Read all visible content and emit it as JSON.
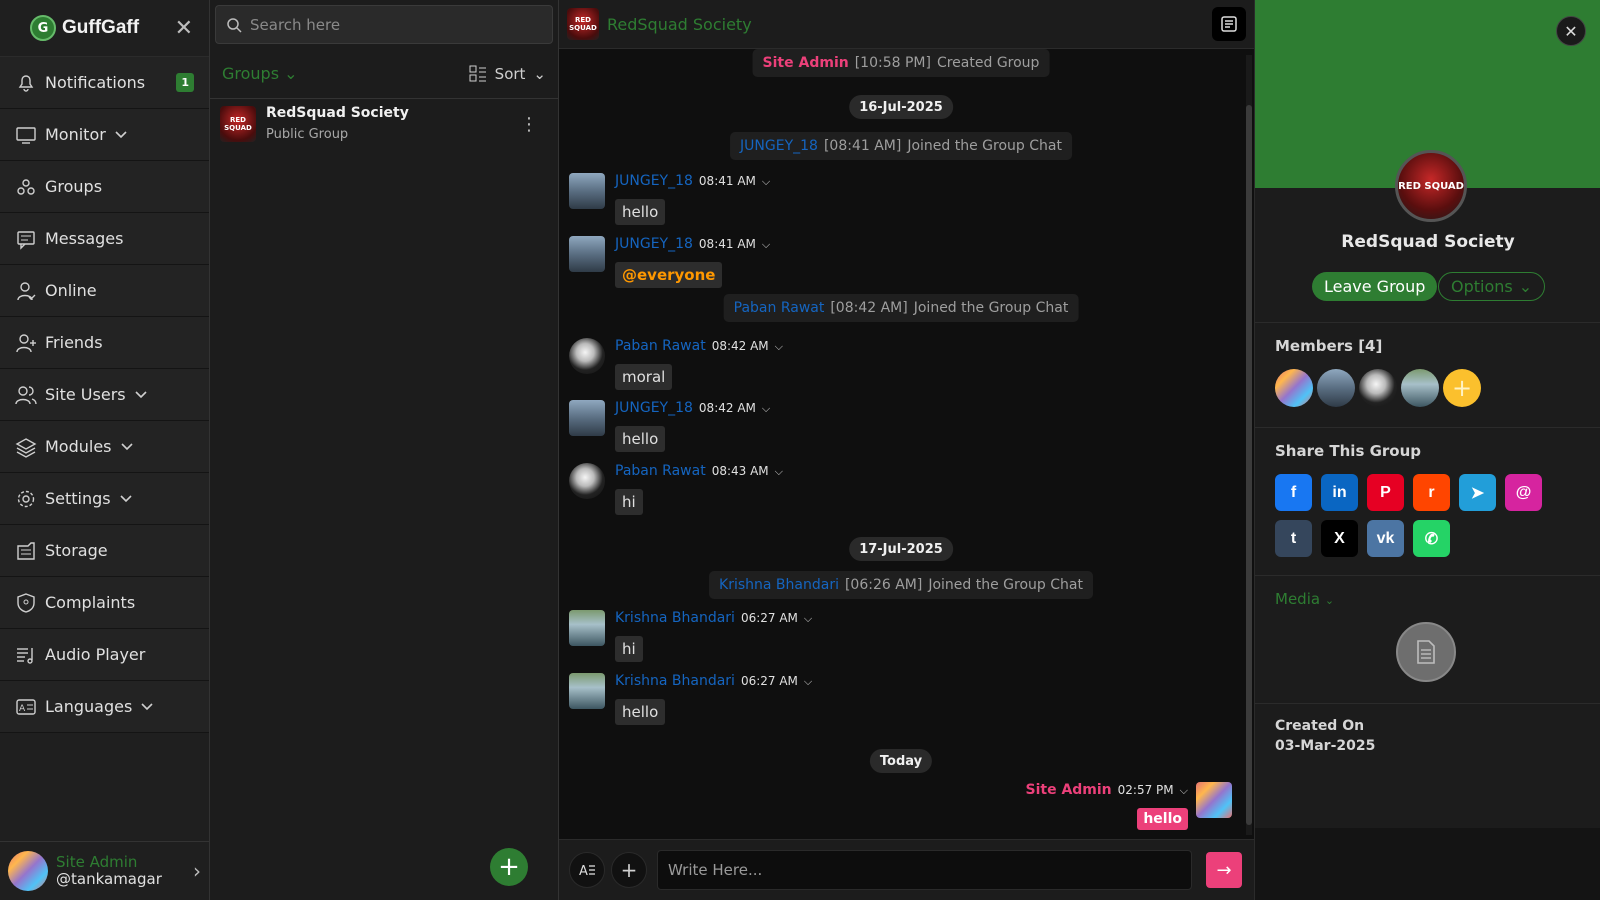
{
  "brand": {
    "name": "GuffGaff",
    "logo_letter": "G"
  },
  "sidebar": {
    "items": [
      {
        "label": "Notifications",
        "icon": "bell-icon",
        "badge": "1",
        "chevron": false
      },
      {
        "label": "Monitor",
        "icon": "monitor-icon",
        "chevron": true
      },
      {
        "label": "Groups",
        "icon": "groups-icon",
        "chevron": false
      },
      {
        "label": "Messages",
        "icon": "messages-icon",
        "chevron": false
      },
      {
        "label": "Online",
        "icon": "online-user-icon",
        "chevron": false
      },
      {
        "label": "Friends",
        "icon": "add-friend-icon",
        "chevron": false
      },
      {
        "label": "Site Users",
        "icon": "users-icon",
        "chevron": true
      },
      {
        "label": "Modules",
        "icon": "layers-icon",
        "chevron": true
      },
      {
        "label": "Settings",
        "icon": "gear-icon",
        "chevron": true
      },
      {
        "label": "Storage",
        "icon": "storage-icon",
        "chevron": false
      },
      {
        "label": "Complaints",
        "icon": "shield-icon",
        "chevron": false
      },
      {
        "label": "Audio Player",
        "icon": "music-list-icon",
        "chevron": false
      },
      {
        "label": "Languages",
        "icon": "language-icon",
        "chevron": true
      }
    ]
  },
  "profile": {
    "name": "Site Admin",
    "handle": "@tankamagar"
  },
  "list_panel": {
    "search_placeholder": "Search here",
    "filter_label": "Groups",
    "sort_label": "Sort",
    "groups": [
      {
        "name": "RedSquad Society",
        "type": "Public Group",
        "avatar_text": "RED SQUAD"
      }
    ]
  },
  "chat": {
    "title": "RedSquad Society",
    "avatar_text": "RED SQUAD",
    "composer_placeholder": "Write Here...",
    "system_events": [
      {
        "who": "Site Admin",
        "role": "admin",
        "time": "[10:58 PM]",
        "text": "Created Group"
      },
      {
        "who": "JUNGEY_18",
        "role": "user",
        "time": "[08:41 AM]",
        "text": "Joined the Group Chat"
      },
      {
        "who": "Paban Rawat",
        "role": "user",
        "time": "[08:42 AM]",
        "text": "Joined the Group Chat"
      },
      {
        "who": "Krishna Bhandari",
        "role": "user",
        "time": "[06:26 AM]",
        "text": "Joined the Group Chat"
      }
    ],
    "dates": [
      "16-Jul-2025",
      "17-Jul-2025",
      "Today"
    ],
    "messages": [
      {
        "user": "JUNGEY_18",
        "time": "08:41 AM",
        "text": "hello",
        "avatar": "av-j"
      },
      {
        "user": "JUNGEY_18",
        "time": "08:41 AM",
        "text": "@everyone",
        "avatar": "av-j",
        "mention": true
      },
      {
        "user": "Paban Rawat",
        "time": "08:42 AM",
        "text": "moral",
        "avatar": "av-p"
      },
      {
        "user": "JUNGEY_18",
        "time": "08:42 AM",
        "text": "hello",
        "avatar": "av-j"
      },
      {
        "user": "Paban Rawat",
        "time": "08:43 AM",
        "text": "hi",
        "avatar": "av-p"
      },
      {
        "user": "Krishna Bhandari",
        "time": "06:27 AM",
        "text": "hi",
        "avatar": "av-k"
      },
      {
        "user": "Krishna Bhandari",
        "time": "06:27 AM",
        "text": "hello",
        "avatar": "av-k"
      }
    ],
    "own_message": {
      "user": "Site Admin",
      "time": "02:57 PM",
      "text": "hello"
    }
  },
  "info": {
    "group_name": "RedSquad Society",
    "avatar_text": "RED SQUAD",
    "leave_label": "Leave Group",
    "options_label": "Options",
    "members_title": "Members [4]",
    "share_title": "Share This Group",
    "share_buttons": [
      {
        "name": "facebook-share-button",
        "glyph": "f",
        "color": "#1877f2"
      },
      {
        "name": "linkedin-share-button",
        "glyph": "in",
        "color": "#0a66c2"
      },
      {
        "name": "pinterest-share-button",
        "glyph": "P",
        "color": "#e60023"
      },
      {
        "name": "reddit-share-button",
        "glyph": "r",
        "color": "#ff4500"
      },
      {
        "name": "telegram-share-button",
        "glyph": "➤",
        "color": "#229ed9"
      },
      {
        "name": "threads-share-button",
        "glyph": "@",
        "color": "#d6249f"
      },
      {
        "name": "tumblr-share-button",
        "glyph": "t",
        "color": "#35465c"
      },
      {
        "name": "x-share-button",
        "glyph": "X",
        "color": "#000000"
      },
      {
        "name": "vk-share-button",
        "glyph": "vk",
        "color": "#4c75a3"
      },
      {
        "name": "whatsapp-share-button",
        "glyph": "✆",
        "color": "#25d366"
      }
    ],
    "media_label": "Media",
    "created_label": "Created On",
    "created_date": "03-Mar-2025"
  },
  "colors": {
    "accent_green": "#2e7d32",
    "accent_pink": "#ec407a",
    "user_blue": "#1565c0"
  }
}
